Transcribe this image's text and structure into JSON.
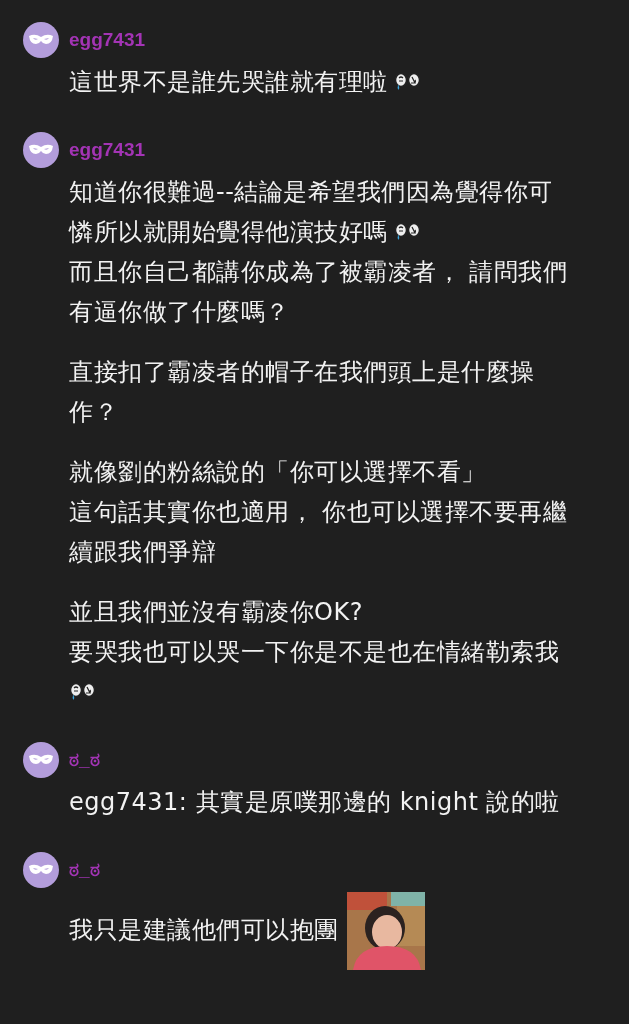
{
  "comments": [
    {
      "user": "egg7431",
      "paragraphs": [
        [
          {
            "text": "這世界不是誰先哭誰就有理啦",
            "emoji": true
          }
        ]
      ]
    },
    {
      "user": "egg7431",
      "paragraphs": [
        [
          {
            "text": "知道你很難過--結論是希望我們因為覺得你可",
            "emoji": false
          },
          {
            "text": "憐所以就開始覺得他演技好嗎",
            "emoji": true
          },
          {
            "text": "而且你自己都講你成為了被霸凌者， 請問我們",
            "emoji": false
          },
          {
            "text": "有逼你做了什麼嗎？",
            "emoji": false
          }
        ],
        [
          {
            "text": "直接扣了霸凌者的帽子在我們頭上是什麼操",
            "emoji": false
          },
          {
            "text": "作？",
            "emoji": false
          }
        ],
        [
          {
            "text": "就像劉的粉絲說的「你可以選擇不看」",
            "emoji": false
          },
          {
            "text": "這句話其實你也適用， 你也可以選擇不要再繼",
            "emoji": false
          },
          {
            "text": "續跟我們爭辯",
            "emoji": false
          }
        ],
        [
          {
            "text": "並且我們並沒有霸凌你OK?",
            "emoji": false
          },
          {
            "text": "要哭我也可以哭一下你是不是也在情緒勒索我",
            "emoji": false
          },
          {
            "emoji": true
          }
        ]
      ]
    },
    {
      "user": "ಠ_ಠ",
      "paragraphs": [
        [
          {
            "text": "egg7431: 其實是原噗那邊的 knight 說的啦",
            "emoji": false
          }
        ]
      ]
    },
    {
      "user": "ಠ_ಠ",
      "paragraphs": [
        [
          {
            "text": "我只是建議他們可以抱團",
            "emoji": false
          }
        ]
      ],
      "sticker": {
        "kind": "picture"
      }
    }
  ]
}
